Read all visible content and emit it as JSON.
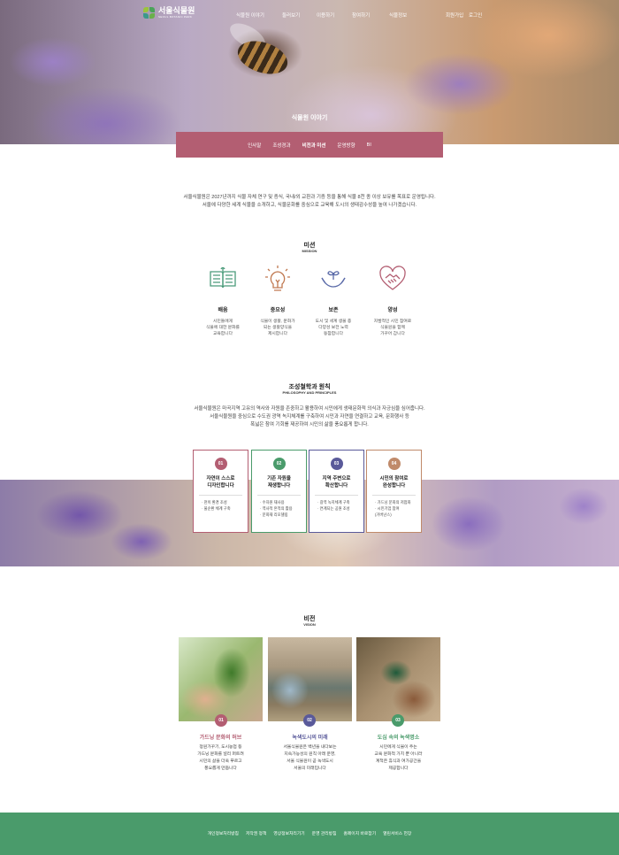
{
  "header": {
    "logo_text": "서울식물원",
    "logo_sub": "SEOUL BOTANIC PARK",
    "menu": [
      "식물원 이야기",
      "둘러보기",
      "이용하기",
      "참여하기",
      "식물정보"
    ],
    "auth": [
      "회원가입",
      "로그인"
    ],
    "page_title": "식물원 이야기"
  },
  "submenu": [
    "인사말",
    "조성경과",
    "비전과 미션",
    "운영방향",
    "BI"
  ],
  "intro": {
    "line1": "서울식물원은 2027년까지 식물 자체 연구 및 증식, 국내/외 교환과 기증 등을 통해 식물 8천 종 이상 보유를 목표로 운영됩니다.",
    "line2": "서울에 다양한 세계 식물을 소개하고, 식물문화를 중심으로 교육해 도시의 생태감수성을 높여 나가겠습니다."
  },
  "mission": {
    "title": "미션",
    "subtitle": "MISSION",
    "items": [
      {
        "icon": "book-icon",
        "title": "배움",
        "lines": [
          "시민들에게",
          "식물에 대한 문화를",
          "교육합니다"
        ]
      },
      {
        "icon": "lightbulb-icon",
        "title": "중요성",
        "lines": [
          "식물이 생활, 문화가",
          "되는 생활양식을",
          "제시합니다"
        ]
      },
      {
        "icon": "hands-plant-icon",
        "title": "보존",
        "lines": [
          "도시 및 세계 생물 종",
          "다양성 보전 노력",
          "동참합니다"
        ]
      },
      {
        "icon": "heart-handshake-icon",
        "title": "양성",
        "lines": [
          "자발적인 시민 참여로",
          "식물원을 함께",
          "가꾸어 갑니다"
        ]
      }
    ],
    "colors": [
      "#4a9b7a",
      "#c07850",
      "#5a6aa8",
      "#b35e72"
    ]
  },
  "philosophy": {
    "title": "조성철학과 원칙",
    "subtitle": "PHILOSOPHY AND PRINCIPLES",
    "line1": "서울식물원은 마곡지역 고유의 역사와 자원을 존중하고 활용하여 시민에게 생태문화적 의식과 자긍심을 심어줍니다.",
    "line2": "서울식물원을 중심으로 수도권 광역 녹지체계를 구축하여 시민과 자연을 연결하고 교육, 문화행사 등",
    "line3": "폭넓은 참여 기회를 제공하여 시민의 삶을 풍요롭게 합니다.",
    "cards": [
      {
        "num": "01",
        "title1": "자연이 스스로",
        "title2": "디자인합니다",
        "points": [
          "· 천이 환경 조성",
          "· 물순환 체계 구축"
        ],
        "color": "#b35e72"
      },
      {
        "num": "02",
        "title1": "기존 자원을",
        "title2": "재생합니다",
        "points": [
          "· 수자원 재사용",
          "· 역사적 흔적의 활용",
          "· 문화재 리모델링"
        ],
        "color": "#4a9b6b"
      },
      {
        "num": "03",
        "title1": "지역 주변으로",
        "title2": "확산합니다",
        "points": [
          "· 광역 녹지체계 구축",
          "· 연계되는 공원 조성"
        ],
        "color": "#5a5a9a"
      },
      {
        "num": "04",
        "title1": "시민의 참여로",
        "title2": "완성합니다",
        "points": [
          "· 가드닝 문화의 저점화",
          "· 시민기업 참여",
          "  (거버넌스)"
        ],
        "color": "#c08a6a"
      }
    ]
  },
  "vision": {
    "title": "비전",
    "subtitle": "VISION",
    "items": [
      {
        "num": "01",
        "title": "가드닝 문화의 허브",
        "lines": [
          "정원가꾸기, 도시농업 등",
          "가드닝 문화를 널리 퍼트려",
          "시민의 삶을 더욱 푸르고",
          "풍요롭게 만듭니다"
        ],
        "color": "#b35e72"
      },
      {
        "num": "02",
        "title": "녹색도시의 미래",
        "lines": [
          "서울식물원은 백년을 내다보는",
          "지속가능성의 원칙 아래 운영,",
          "서울 식물원이 곧 녹색도시",
          "서울의 미래입니다"
        ],
        "color": "#5a5a9a"
      },
      {
        "num": "03",
        "title": "도심 속의 녹색명소",
        "lines": [
          "시민에게 식물이 주는",
          "교육 문화적 가치 뿐 아니라",
          "계적은 휴식과 여가공간을",
          "제공합니다"
        ],
        "color": "#4a9b6b"
      }
    ]
  },
  "footer": {
    "links": [
      "개인정보처리방침",
      "저작권 정책",
      "영상정보처리기기",
      "운영 관리방침",
      "홈페이지 바로잡기",
      "열린서비스 헌장"
    ]
  }
}
